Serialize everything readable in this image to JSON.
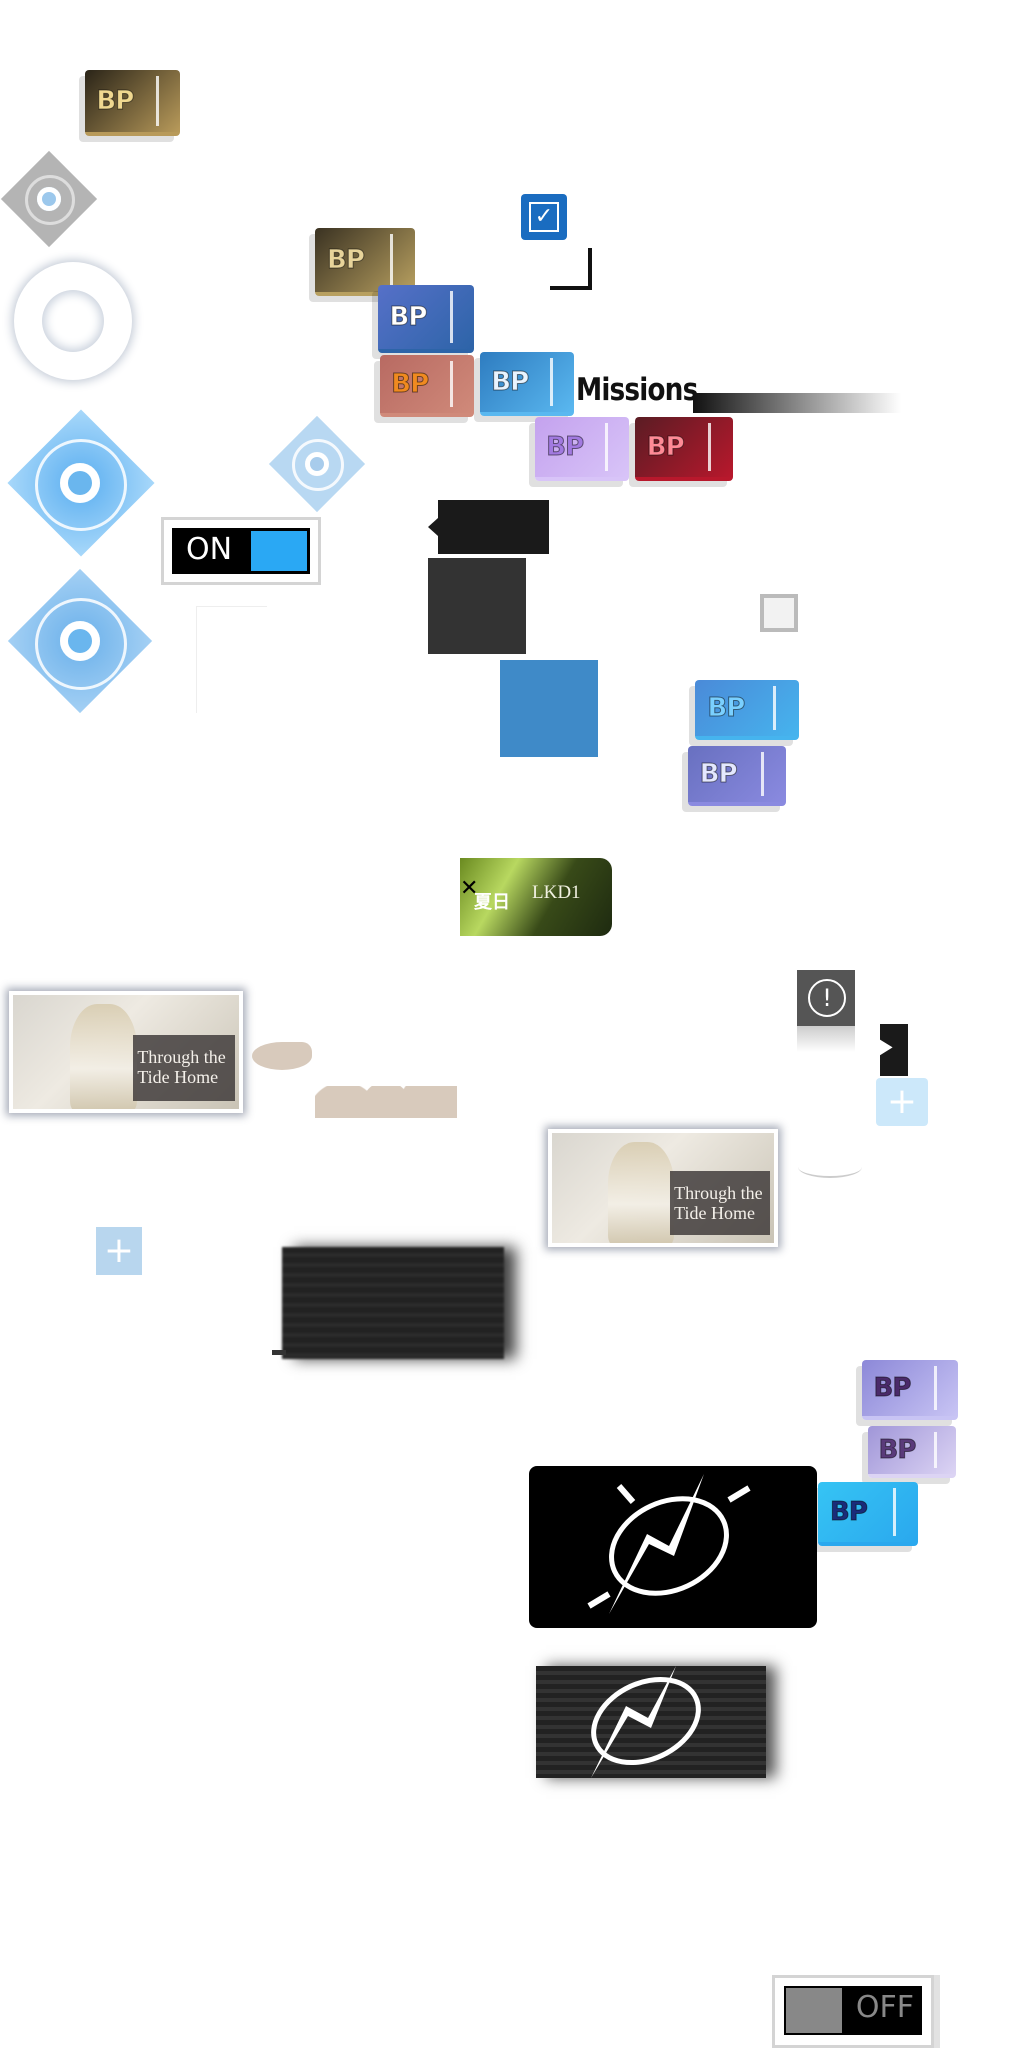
{
  "tickets": [
    {
      "label": "BP",
      "bg": "#2a2418",
      "text": "#f0d890",
      "edge": "#b89a5a"
    },
    {
      "label": "BP",
      "bg": "#3a3222",
      "text": "#e8d49a",
      "edge": "#b8a060"
    },
    {
      "label": "BP",
      "bg": "#5670c8",
      "text": "#ffffff",
      "edge": "#2d64a8"
    },
    {
      "label": "BP",
      "bg": "#b86a62",
      "text": "#f08a20",
      "edge": "#d08a7a"
    },
    {
      "label": "BP",
      "bg": "#2e7cc0",
      "text": "#e8f4ff",
      "edge": "#5ab8f0"
    },
    {
      "label": "BP",
      "bg": "#c4a2ee",
      "text": "#a27ae0",
      "edge": "#d8c4f8"
    },
    {
      "label": "BP",
      "bg": "#5a1c24",
      "text": "#ff8a96",
      "edge": "#b8182c"
    },
    {
      "label": "BP",
      "bg": "#4a8ad8",
      "text": "#7ad0ff",
      "edge": "#46b4ee"
    },
    {
      "label": "BP",
      "bg": "#6870c0",
      "text": "#e4e8ff",
      "edge": "#8a8ae0"
    },
    {
      "label": "BP",
      "bg": "#8c88d8",
      "text": "#4a2a6a",
      "edge": "#c8c4f4"
    },
    {
      "label": "BP",
      "bg": "#a096d8",
      "text": "#5a3a7a",
      "edge": "#dcd4f4"
    },
    {
      "label": "BP",
      "bg": "#36c4f4",
      "text": "#1a2c7a",
      "edge": "#2aa8ee"
    }
  ],
  "missions": {
    "label": "Missions"
  },
  "toggle_on": {
    "label": "ON",
    "accent": "#2aa8f4"
  },
  "toggle_off": {
    "label": "OFF",
    "knob": "#888888"
  },
  "checkbox": {
    "checked": true,
    "color": "#1a6cc0"
  },
  "stage_banner": {
    "title": "夏日",
    "code": "LKD1"
  },
  "story_cards": [
    {
      "line1": "Through the",
      "line2": "Tide Home"
    },
    {
      "line1": "Through the",
      "line2": "Tide Home"
    }
  ],
  "icons": {
    "diamond_grey": "target-icon",
    "ring": "ring-icon",
    "alert": "exclamation-icon",
    "add": "plus-icon",
    "lightning": "lightning-emblem-icon"
  },
  "colors": {
    "diamond_blue": "#8cc8f4",
    "diamond_grey": "#b4b4b4",
    "dark_panel": "#333333",
    "blue_panel": "#3f8ac8"
  }
}
